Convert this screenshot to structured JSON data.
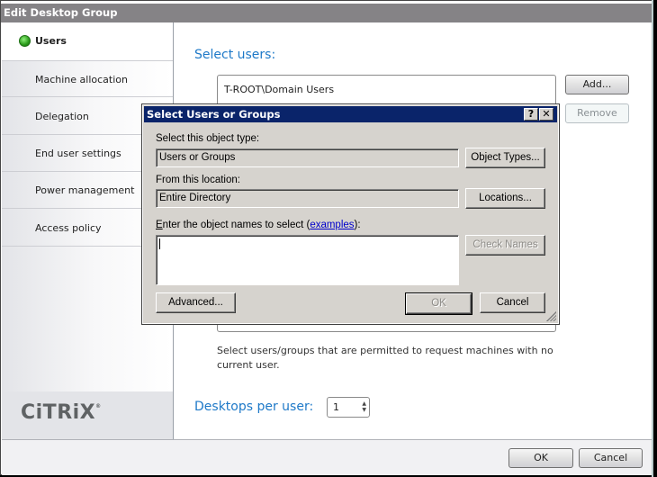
{
  "window": {
    "title": "Edit Desktop Group"
  },
  "sidebar": {
    "items": [
      {
        "label": "Users",
        "active": true
      },
      {
        "label": "Machine allocation"
      },
      {
        "label": "Delegation"
      },
      {
        "label": "End user settings"
      },
      {
        "label": "Power management"
      },
      {
        "label": "Access policy"
      }
    ],
    "logo": "CiTRiX",
    "logo_mark": "®"
  },
  "main": {
    "select_users_heading": "Select users:",
    "users_list": [
      "T-ROOT\\Domain Users"
    ],
    "add_button": "Add...",
    "remove_button": "Remove",
    "help_text": "Select users/groups that are permitted to request machines with no current user.",
    "desktops_per_user_label": "Desktops per user:",
    "desktops_per_user_value": "1"
  },
  "footer": {
    "ok_button": "OK",
    "cancel_button": "Cancel"
  },
  "dialog": {
    "title": "Select Users or Groups",
    "help_button": "?",
    "close_button": "✕",
    "object_type_label": "Select this object type:",
    "object_type_value": "Users or Groups",
    "object_types_button": "Object Types...",
    "location_label": "From this location:",
    "location_value": "Entire Directory",
    "locations_button": "Locations...",
    "names_label_prefix": "E",
    "names_label_rest": "nter the object names to select (",
    "names_label_link": "examples",
    "names_label_suffix": "):",
    "names_value": "",
    "check_names_button": "Check Names",
    "advanced_button": "Advanced...",
    "ok_button": "OK",
    "cancel_button": "Cancel"
  }
}
